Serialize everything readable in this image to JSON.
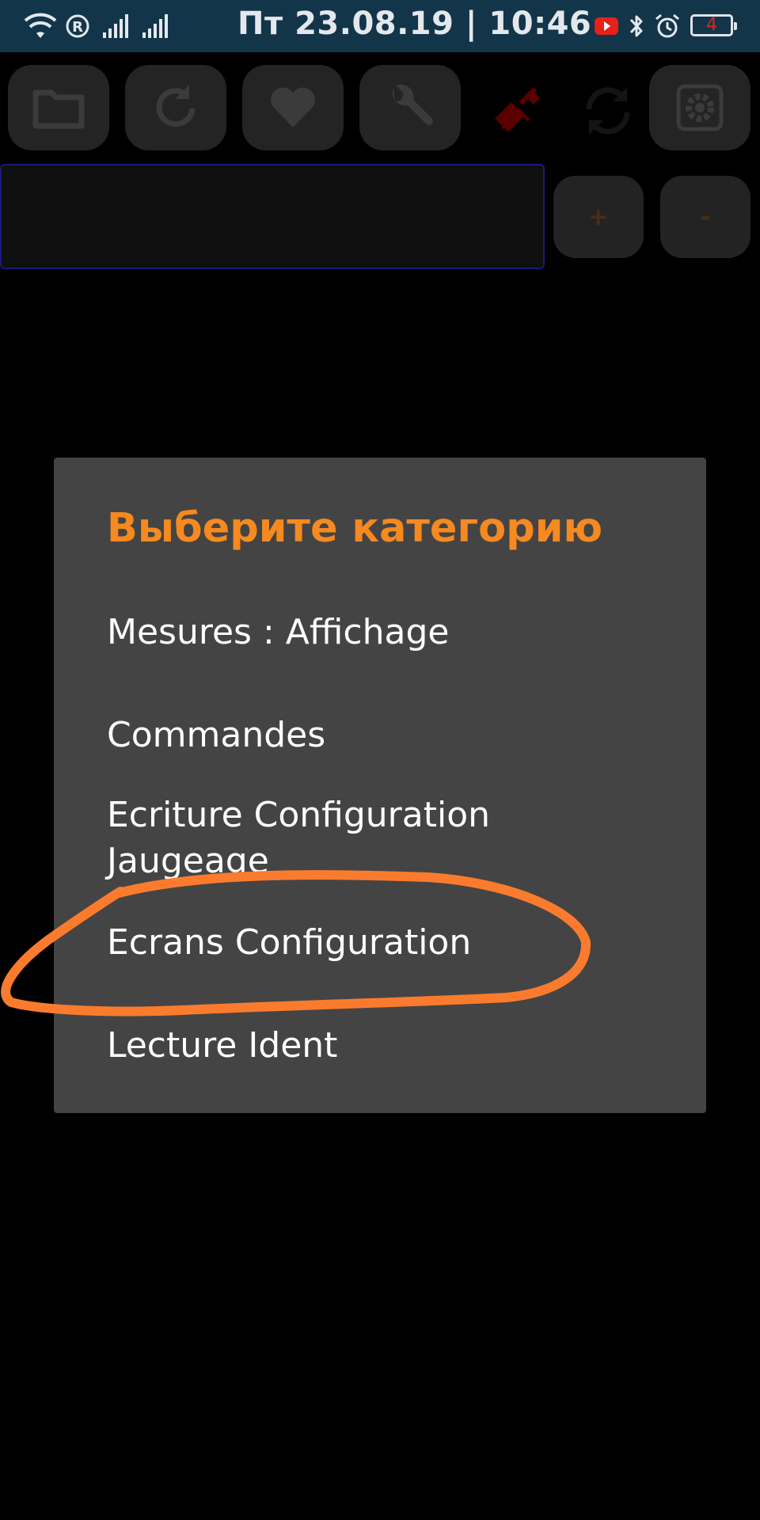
{
  "status_bar": {
    "clock": "Пт 23.08.19 | 10:46",
    "battery_level": "4",
    "icons": [
      "wifi-icon",
      "registered-icon",
      "signal-icon",
      "signal-icon",
      "youtube-icon",
      "bluetooth-icon",
      "alarm-icon",
      "battery-icon"
    ]
  },
  "toolbar": {
    "buttons": [
      "folder-icon",
      "refresh-icon",
      "heart-icon",
      "wrench-icon",
      "disconnected-plug-icon",
      "sync-icon",
      "settings-icon"
    ]
  },
  "value_row": {
    "field_value": "",
    "plus_label": "+",
    "minus_label": "-"
  },
  "dialog": {
    "title": "Выберите категорию",
    "items": [
      {
        "label": "Mesures : Affichage"
      },
      {
        "label": "Commandes"
      },
      {
        "label_line1": "Ecriture Configuration",
        "label_line2": "Jaugeage"
      },
      {
        "label": "Ecrans Configuration"
      },
      {
        "label": "Lecture Ident"
      }
    ]
  },
  "colors": {
    "status_bar_bg": "#12354a",
    "accent_orange": "#f6891f",
    "annotation_orange": "#fb7b2e",
    "dialog_bg": "#444444"
  }
}
